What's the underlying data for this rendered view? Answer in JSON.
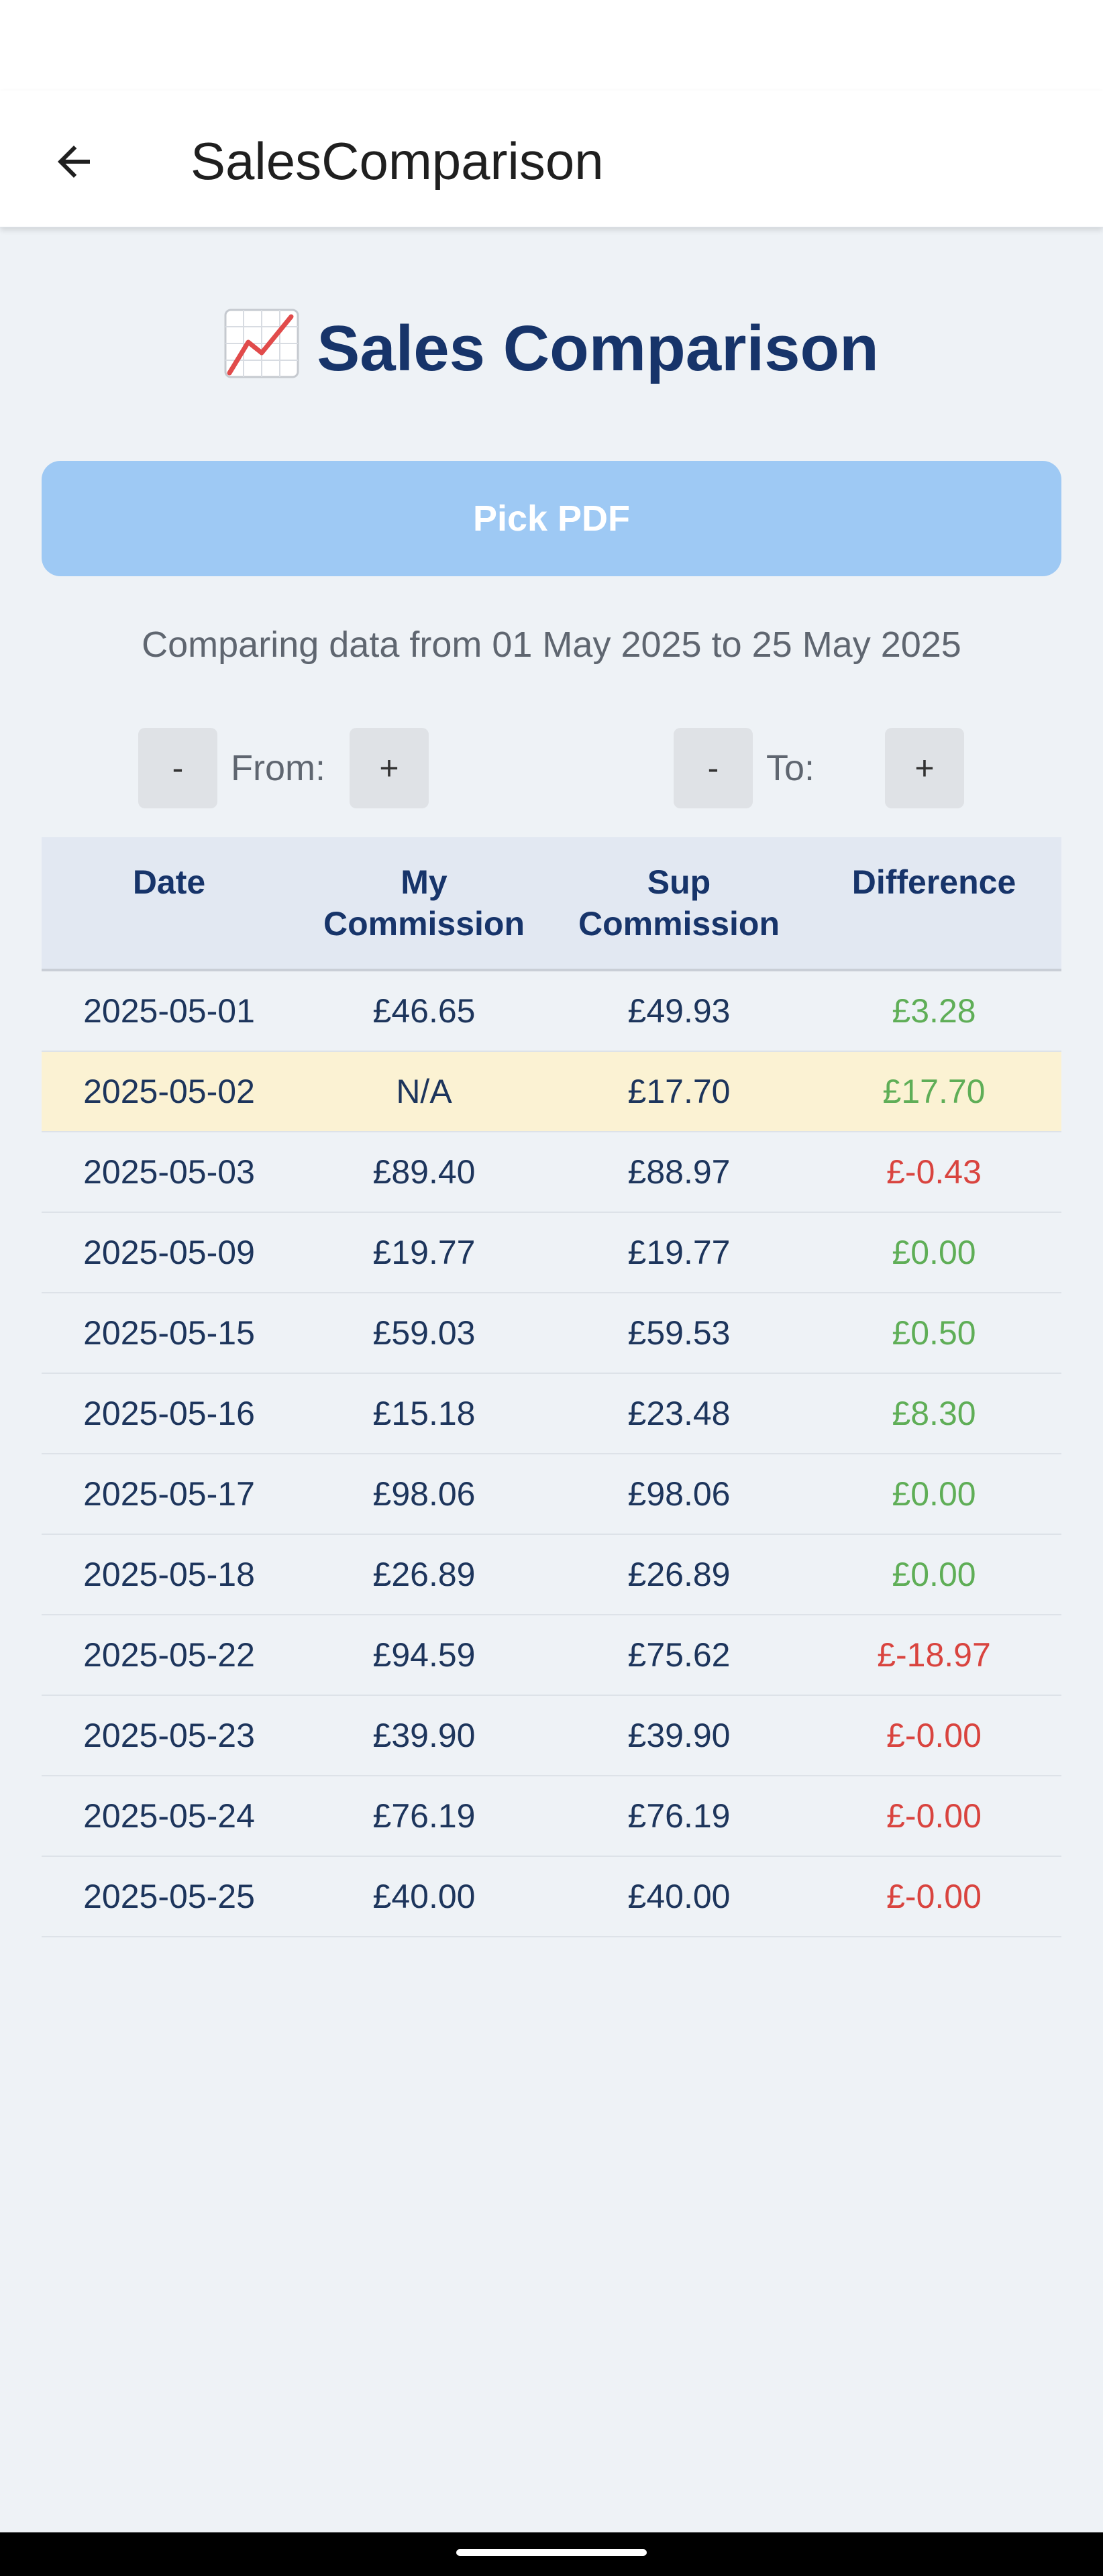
{
  "app_bar": {
    "title": "SalesComparison",
    "back_icon": "arrow-left-icon"
  },
  "main": {
    "heading": "Sales Comparison",
    "heading_icon": "chart-increasing-icon",
    "pick_pdf_label": "Pick PDF",
    "range_text": "Comparing data from 01 May 2025 to 25 May 2025",
    "from": {
      "label": "From:",
      "minus": "-",
      "plus": "+"
    },
    "to": {
      "label": "To:",
      "minus": "-",
      "plus": "+"
    }
  },
  "table": {
    "headers": [
      "Date",
      "My\nCommission",
      "Sup\nCommission",
      "Difference"
    ],
    "rows": [
      {
        "date": "2025-05-01",
        "my": "£46.65",
        "sup": "£49.93",
        "diff": "£3.28",
        "status": "pos",
        "highlight": false
      },
      {
        "date": "2025-05-02",
        "my": "N/A",
        "sup": "£17.70",
        "diff": "£17.70",
        "status": "pos",
        "highlight": true
      },
      {
        "date": "2025-05-03",
        "my": "£89.40",
        "sup": "£88.97",
        "diff": "£-0.43",
        "status": "neg",
        "highlight": false
      },
      {
        "date": "2025-05-09",
        "my": "£19.77",
        "sup": "£19.77",
        "diff": "£0.00",
        "status": "pos",
        "highlight": false
      },
      {
        "date": "2025-05-15",
        "my": "£59.03",
        "sup": "£59.53",
        "diff": "£0.50",
        "status": "pos",
        "highlight": false
      },
      {
        "date": "2025-05-16",
        "my": "£15.18",
        "sup": "£23.48",
        "diff": "£8.30",
        "status": "pos",
        "highlight": false
      },
      {
        "date": "2025-05-17",
        "my": "£98.06",
        "sup": "£98.06",
        "diff": "£0.00",
        "status": "pos",
        "highlight": false
      },
      {
        "date": "2025-05-18",
        "my": "£26.89",
        "sup": "£26.89",
        "diff": "£0.00",
        "status": "pos",
        "highlight": false
      },
      {
        "date": "2025-05-22",
        "my": "£94.59",
        "sup": "£75.62",
        "diff": "£-18.97",
        "status": "neg",
        "highlight": false
      },
      {
        "date": "2025-05-23",
        "my": "£39.90",
        "sup": "£39.90",
        "diff": "£-0.00",
        "status": "neg",
        "highlight": false
      },
      {
        "date": "2025-05-24",
        "my": "£76.19",
        "sup": "£76.19",
        "diff": "£-0.00",
        "status": "neg",
        "highlight": false
      },
      {
        "date": "2025-05-25",
        "my": "£40.00",
        "sup": "£40.00",
        "diff": "£-0.00",
        "status": "neg",
        "highlight": false
      }
    ]
  },
  "colors": {
    "heading": "#17346a",
    "button": "#9ec9f4",
    "positive": "#5fae57",
    "negative": "#d9443f",
    "highlight_row": "#fbf2d3"
  }
}
